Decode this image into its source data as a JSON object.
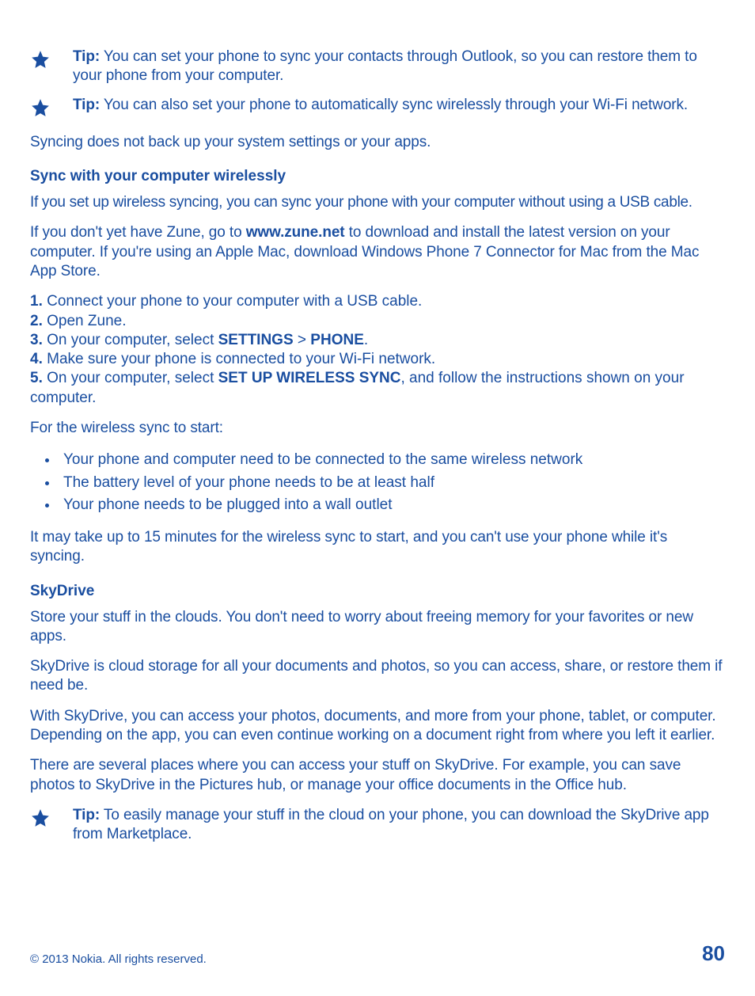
{
  "tips": {
    "t1": {
      "label": "Tip:",
      "text": " You can set your phone to sync your contacts through Outlook, so you can restore them to your phone from your computer."
    },
    "t2": {
      "label": "Tip:",
      "text": " You can also set your phone to automatically sync wirelessly through your Wi-Fi network."
    },
    "t3": {
      "label": "Tip:",
      "text": " To easily manage your stuff in the cloud on your phone, you can download the SkyDrive app from Marketplace."
    }
  },
  "syncNote": "Syncing does not back up your system settings or your apps.",
  "wireless": {
    "heading": "Sync with your computer wirelessly",
    "intro": "If you set up wireless syncing, you can sync your phone with your computer without using a USB cable.",
    "zune_pre": "If you don't yet have Zune, go to ",
    "zune_link": "www.zune.net",
    "zune_post": " to download and install the latest version on your computer. If you're using an Apple Mac, download Windows Phone 7 Connector for Mac from the Mac App Store.",
    "steps": {
      "s1_n": "1.",
      "s1_t": " Connect your phone to your computer with a USB cable.",
      "s2_n": "2.",
      "s2_t": " Open Zune.",
      "s3_n": "3.",
      "s3_pre": " On your computer, select ",
      "s3_b1": "SETTINGS",
      "s3_gt": " > ",
      "s3_b2": "PHONE",
      "s3_dot": ".",
      "s4_n": "4.",
      "s4_t": " Make sure your phone is connected to your Wi-Fi network.",
      "s5_n": "5.",
      "s5_pre": " On your computer, select ",
      "s5_b": "SET UP WIRELESS SYNC",
      "s5_post": ", and follow the instructions shown on your computer."
    },
    "condIntro": "For the wireless sync to start:",
    "conds": {
      "c1": "Your phone and computer need to be connected to the same wireless network",
      "c2": "The battery level of your phone needs to be at least half",
      "c3": "Your phone needs to be plugged into a wall outlet"
    },
    "note": "It may take up to 15 minutes for the wireless sync to start, and you can't use your phone while it's syncing."
  },
  "skydrive": {
    "heading": "SkyDrive",
    "p1": "Store your stuff in the clouds. You don't need to worry about freeing memory for your favorites or new apps.",
    "p2": "SkyDrive is cloud storage for all your documents and photos, so you can access, share, or restore them if need be.",
    "p3": "With SkyDrive, you can access your photos, documents, and more from your phone, tablet, or computer. Depending on the app, you can even continue working on a document right from where you left it earlier.",
    "p4": "There are several places where you can access your stuff on SkyDrive. For example, you can save photos to SkyDrive in the Pictures hub, or manage your office documents in the Office hub."
  },
  "footer": {
    "copyright": "© 2013 Nokia. All rights reserved.",
    "page": "80"
  }
}
